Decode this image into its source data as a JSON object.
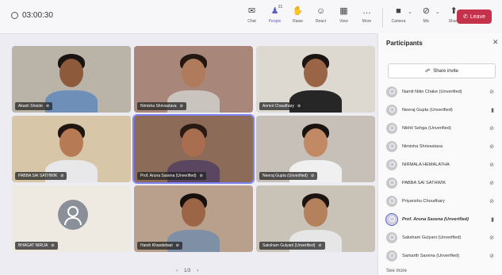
{
  "meeting": {
    "timer": "03:00:30"
  },
  "toolbar": {
    "items": [
      {
        "label": "Chat",
        "icon": "chat-icon",
        "glyph": "✉"
      },
      {
        "label": "People",
        "icon": "people-icon",
        "glyph": "♟",
        "badge": "21"
      },
      {
        "label": "Raise",
        "icon": "raise-hand-icon",
        "glyph": "✋"
      },
      {
        "label": "React",
        "icon": "react-icon",
        "glyph": "☺"
      },
      {
        "label": "View",
        "icon": "view-icon",
        "glyph": "▦"
      },
      {
        "label": "More",
        "icon": "more-icon",
        "glyph": "…"
      }
    ],
    "devices": [
      {
        "label": "Camera",
        "icon": "camera-icon",
        "glyph": "■"
      },
      {
        "label": "Mic",
        "icon": "mic-off-icon",
        "glyph": "⊘"
      },
      {
        "label": "Share",
        "icon": "share-icon",
        "glyph": "⬆"
      }
    ],
    "leave_label": "Leave",
    "leave_color": "#c4314b",
    "accent": "#5b5fc7"
  },
  "tiles": [
    {
      "name": "Akash Sheide",
      "bg": "#b9b3a8",
      "skin": "#8d5a3b",
      "hair": "#1a1410",
      "shirt": "#6d8fb8",
      "kind": "person"
    },
    {
      "name": "Nimisha Shrivastava",
      "bg": "#a8877a",
      "skin": "#b07a5c",
      "hair": "#241611",
      "shirt": "#c9c4bd",
      "kind": "person"
    },
    {
      "name": "Anmol Chaudhary",
      "bg": "#ddd8d0",
      "skin": "#9a6547",
      "hair": "#1c1410",
      "shirt": "#262626",
      "kind": "person"
    },
    {
      "name": "PABBA SAI SATHWIK",
      "bg": "#d8c6a8",
      "skin": "#b67a55",
      "hair": "#1f1612",
      "shirt": "#e8e8ea",
      "kind": "person"
    },
    {
      "name": "Prof. Aruna Saxena (Unverified)",
      "bg": "#8c6b58",
      "skin": "#a96e4f",
      "hair": "#2a1a14",
      "shirt": "#5a4660",
      "kind": "person",
      "speaking": true
    },
    {
      "name": "Neeraj Gupta (Unverified)",
      "bg": "#c7c0b8",
      "skin": "#c28a64",
      "hair": "#1a1410",
      "shirt": "#f0f0f0",
      "kind": "person"
    },
    {
      "name": "BHAGAT NIRIJA",
      "bg": "#eeeae2",
      "kind": "avatar"
    },
    {
      "name": "Harsh Khandelwal",
      "bg": "#b8a08c",
      "skin": "#9c6646",
      "hair": "#17110e",
      "shirt": "#7f8fa6",
      "kind": "person"
    },
    {
      "name": "Saksham Gulyani (Unverified)",
      "bg": "#c9c2b6",
      "skin": "#b5805c",
      "hair": "#1c1410",
      "shirt": "#e6e6e6",
      "kind": "person"
    }
  ],
  "pager": {
    "prev": "‹",
    "page": "1/3",
    "next": "›"
  },
  "participants_panel": {
    "title": "Participants",
    "share_invite": "Share invite",
    "items": [
      {
        "name": "Namit Nitin Chake (Unverified)",
        "mic": "mic-off-icon",
        "glyph": "⊘"
      },
      {
        "name": "Neeraj Gupta (Unverified)",
        "mic": "mic-on-icon",
        "glyph": "▮"
      },
      {
        "name": "Nikhil Sehga (Unverified)",
        "mic": "mic-off-icon",
        "glyph": "⊘"
      },
      {
        "name": "Nimisha Shrivastava",
        "mic": "mic-off-icon",
        "glyph": "⊘"
      },
      {
        "name": "NIRMALA HEMALATHA",
        "mic": "mic-off-icon",
        "glyph": "⊘"
      },
      {
        "name": "PABBA SAI SATHWIK",
        "mic": "mic-off-icon",
        "glyph": "⊘"
      },
      {
        "name": "Priyanshu Choudhary",
        "mic": "mic-off-icon",
        "glyph": "⊘"
      },
      {
        "name": "Prof. Aruna Saxena (Unverified)",
        "mic": "mic-on-icon",
        "glyph": "▮",
        "highlight": true
      },
      {
        "name": "Saksham Gulyani (Unverified)",
        "mic": "mic-off-icon",
        "glyph": "⊘"
      },
      {
        "name": "Samarth Saxena (Unverified)",
        "mic": "mic-off-icon",
        "glyph": "⊘"
      }
    ],
    "see_more": "See more"
  }
}
